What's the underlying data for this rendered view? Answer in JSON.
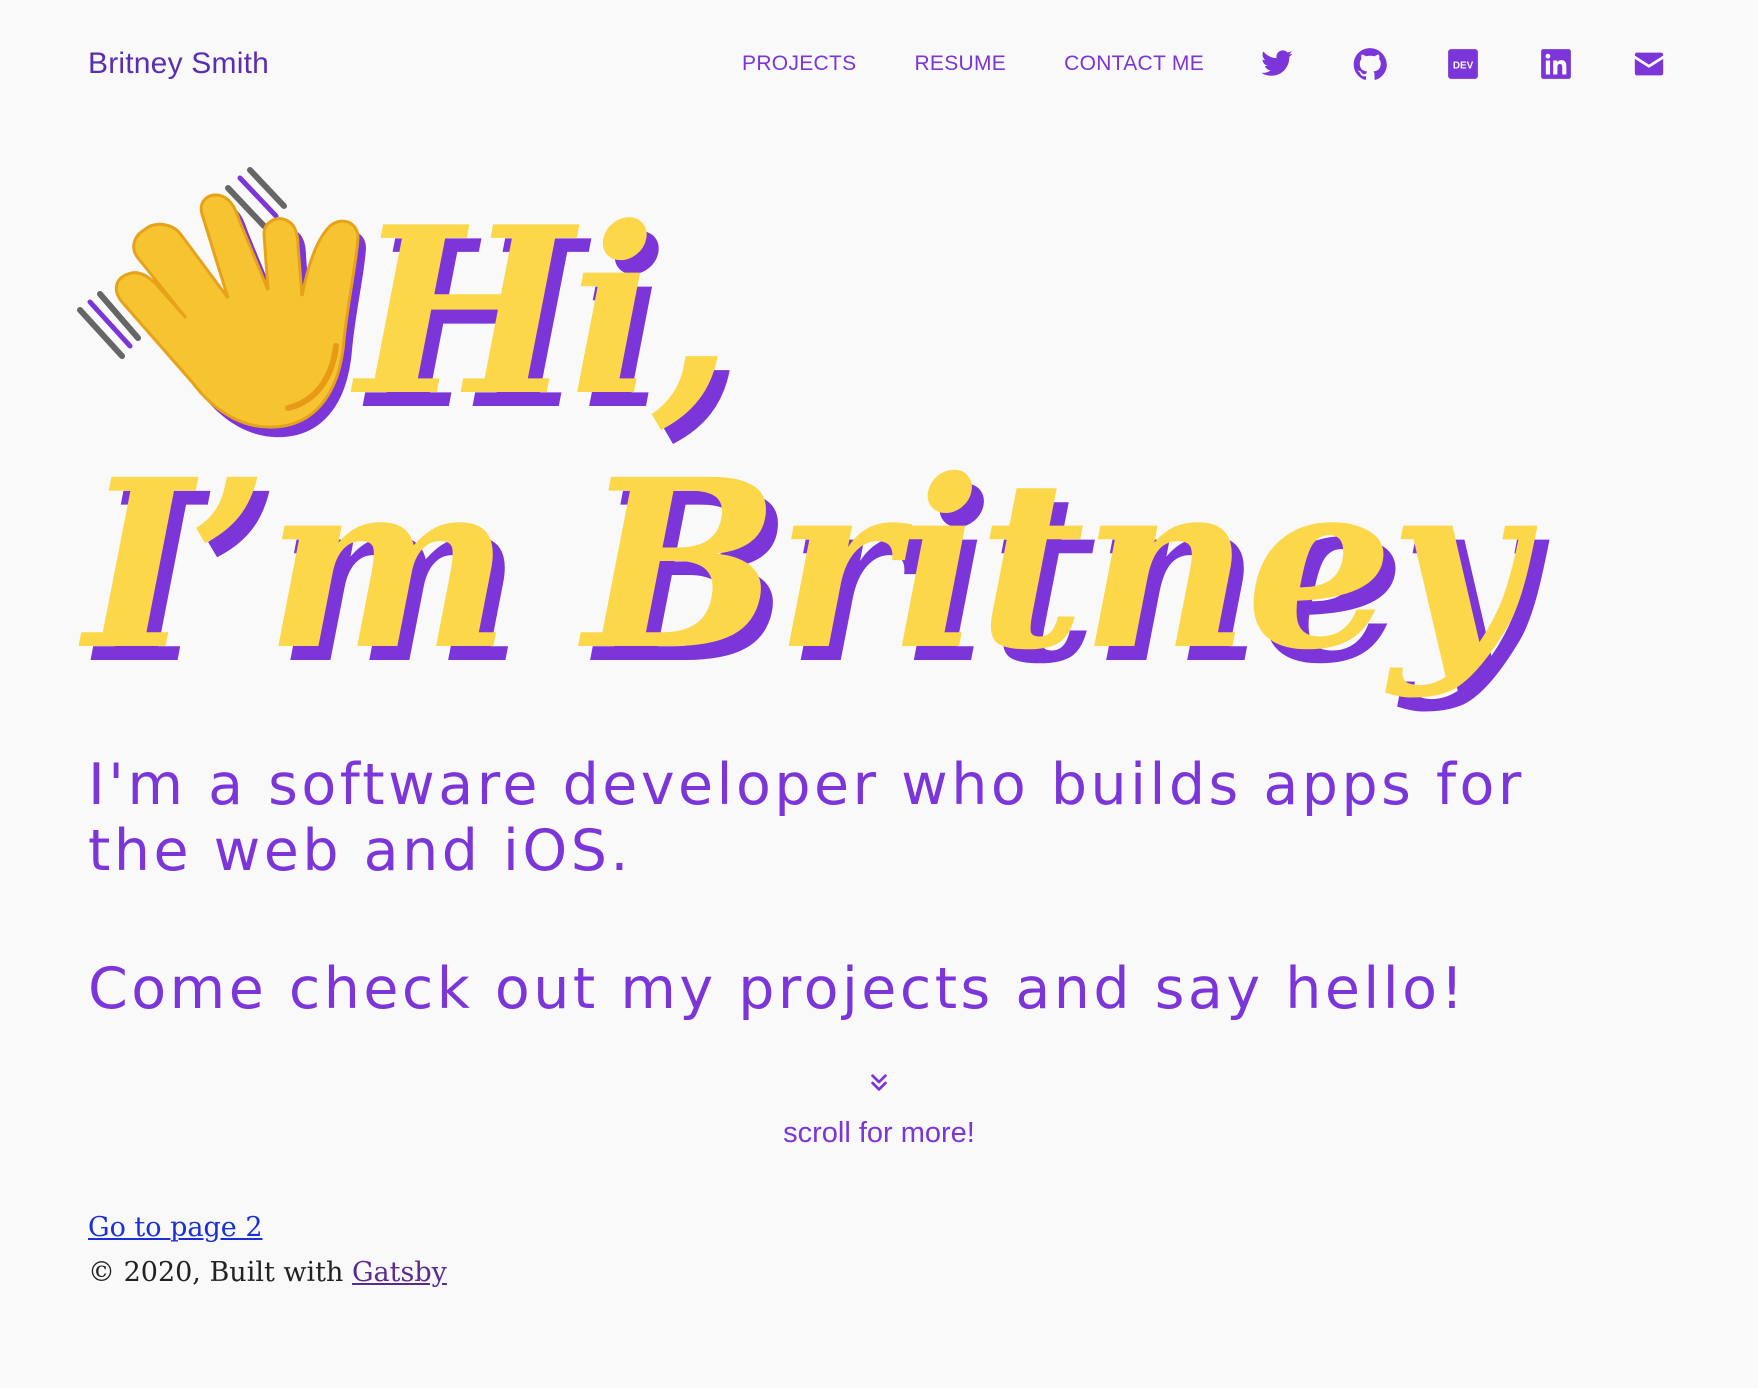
{
  "header": {
    "brand": "Britney Smith",
    "nav": [
      {
        "label": "PROJECTS"
      },
      {
        "label": "RESUME"
      },
      {
        "label": "CONTACT ME"
      }
    ],
    "social": [
      {
        "icon": "twitter-icon"
      },
      {
        "icon": "github-icon"
      },
      {
        "icon": "dev-icon"
      },
      {
        "icon": "linkedin-icon"
      },
      {
        "icon": "email-icon"
      }
    ]
  },
  "hero": {
    "emoji": "👋",
    "line1": "Hi,",
    "line2": "I’m Britney",
    "fill_color": "#fbd749",
    "shadow_color": "#7b35d8"
  },
  "intro": "I'm a software developer who builds apps for the web and iOS.",
  "cta": "Come check out my projects and say hello!",
  "scroll": {
    "icon": "chevrons-down-icon",
    "label": "scroll for more!"
  },
  "footer": {
    "page_link": "Go to page 2",
    "copyright_prefix": "© 2020, Built with",
    "gatsby_link": "Gatsby"
  },
  "colors": {
    "accent": "#7b35d8",
    "yellow": "#fbd749",
    "background": "#f9f9f9",
    "link_blue": "#1a2fd6"
  }
}
